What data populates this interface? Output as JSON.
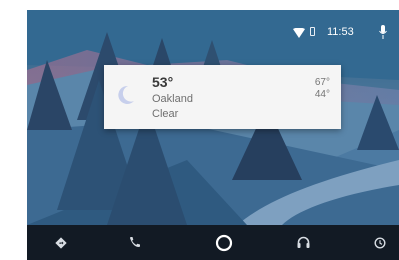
{
  "status_bar": {
    "time": "11:53",
    "icons": [
      "wifi-icon",
      "battery-icon",
      "microphone-icon"
    ]
  },
  "weather_card": {
    "icon": "moon-icon",
    "temperature": "53°",
    "city": "Oakland",
    "condition": "Clear",
    "high": "67°",
    "low": "44°"
  },
  "nav_bar": {
    "items": [
      {
        "icon": "navigation-icon"
      },
      {
        "icon": "phone-icon"
      },
      {
        "icon": "home-circle-icon"
      },
      {
        "icon": "headphones-icon"
      },
      {
        "icon": "clock-icon"
      }
    ]
  },
  "colors": {
    "navbar": "#121a24",
    "card": "#f5f5f5",
    "accent_moon": "#c7cfec"
  }
}
